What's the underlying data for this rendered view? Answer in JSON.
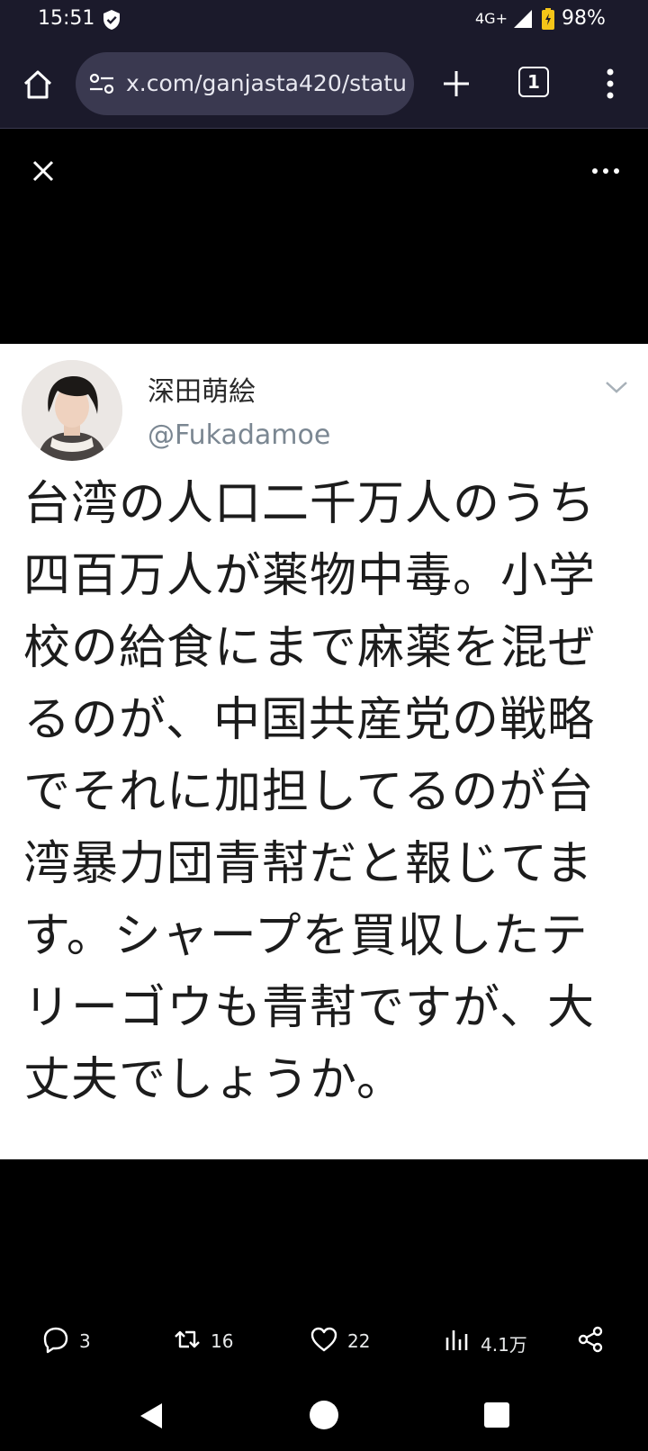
{
  "status_bar": {
    "time": "15:51",
    "network": "4G+",
    "battery": "98%"
  },
  "browser": {
    "url": "x.com/ganjasta420/statu",
    "tab_count": "1"
  },
  "tweet": {
    "author_name": "深田萌絵",
    "author_handle": "@Fukadamoe",
    "text_lines": [
      "台湾の人口二千万人のうち",
      "四百万人が薬物中毒。小学",
      "校の給食にまで麻薬を混ぜ",
      "るのが、中国共産党の戦略",
      "でそれに加担してるのが台",
      "湾暴力団青幇だと報じてま",
      "す。シャープを買収したテ",
      "リーゴウも青幇ですが、大",
      "丈夫でしょうか。"
    ]
  },
  "actions": {
    "replies": "3",
    "reposts": "16",
    "likes": "22",
    "views": "4.1万"
  },
  "colors": {
    "status_bg": "#1b1a2b",
    "urlbar_bg": "#3a3950",
    "card_bg": "#ffffff",
    "handle": "#7b8792"
  }
}
